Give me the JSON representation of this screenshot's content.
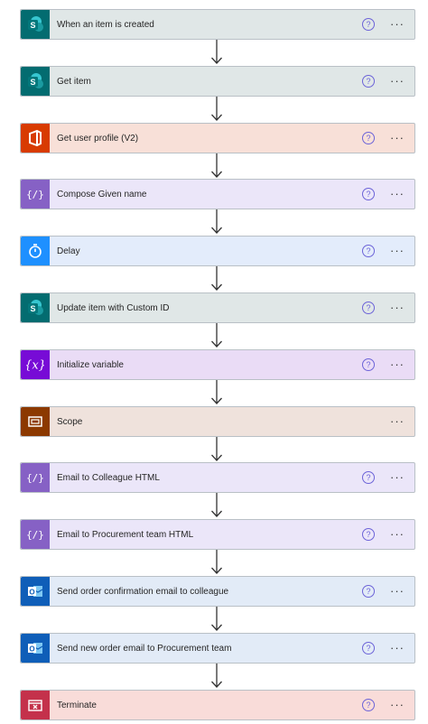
{
  "flow": {
    "steps": [
      {
        "label": "When an item is created",
        "icon": "sharepoint-icon",
        "icon_bg": "#036c70",
        "bar_bg": "#e0e7e7",
        "help": true
      },
      {
        "label": "Get item",
        "icon": "sharepoint-icon",
        "icon_bg": "#036c70",
        "bar_bg": "#e0e7e7",
        "help": true
      },
      {
        "label": "Get user profile (V2)",
        "icon": "office-icon",
        "icon_bg": "#d83b01",
        "bar_bg": "#f8e0d8",
        "help": true
      },
      {
        "label": "Compose Given name",
        "icon": "compose-icon",
        "icon_bg": "#8661c5",
        "bar_bg": "#ebe6f9",
        "help": true
      },
      {
        "label": "Delay",
        "icon": "timer-icon",
        "icon_bg": "#1e90ff",
        "bar_bg": "#e3ecfb",
        "help": true
      },
      {
        "label": "Update item with Custom ID",
        "icon": "sharepoint-icon",
        "icon_bg": "#036c70",
        "bar_bg": "#e0e7e7",
        "help": true
      },
      {
        "label": "Initialize variable",
        "icon": "variable-icon",
        "icon_bg": "#770bd6",
        "bar_bg": "#eadcf6",
        "help": true
      },
      {
        "label": "Scope",
        "icon": "scope-icon",
        "icon_bg": "#8c3900",
        "bar_bg": "#efe2dc",
        "help": false
      },
      {
        "label": "Email to Colleague HTML",
        "icon": "compose-icon",
        "icon_bg": "#8661c5",
        "bar_bg": "#ebe6f9",
        "help": true
      },
      {
        "label": "Email to Procurement team HTML",
        "icon": "compose-icon",
        "icon_bg": "#8661c5",
        "bar_bg": "#ebe6f9",
        "help": true
      },
      {
        "label": "Send order confirmation email to colleague",
        "icon": "outlook-icon",
        "icon_bg": "#0f5eb8",
        "bar_bg": "#e2ebf7",
        "help": true
      },
      {
        "label": "Send new order email to Procurement team",
        "icon": "outlook-icon",
        "icon_bg": "#0f5eb8",
        "bar_bg": "#e2ebf7",
        "help": true
      },
      {
        "label": "Terminate",
        "icon": "terminate-icon",
        "icon_bg": "#c4314b",
        "bar_bg": "#f9dcd9",
        "help": true
      }
    ],
    "help_glyph": "?",
    "more_glyph": "···"
  }
}
